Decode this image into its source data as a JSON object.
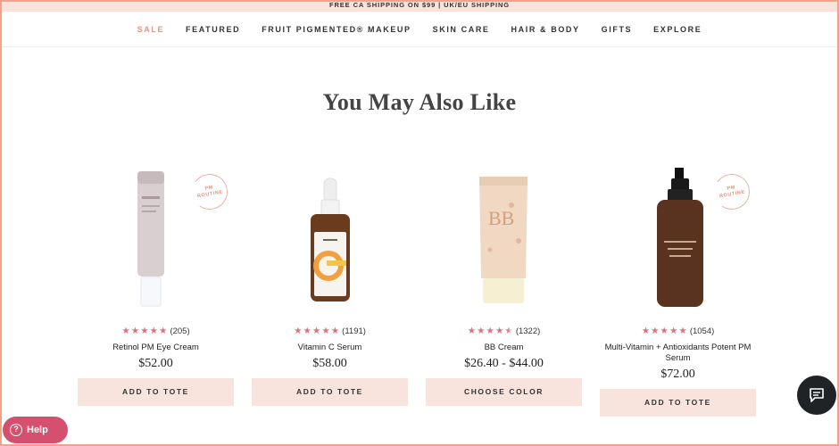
{
  "promo": {
    "text": "FREE CA SHIPPING ON $99 | UK/EU SHIPPING"
  },
  "nav": {
    "items": [
      {
        "label": "SALE"
      },
      {
        "label": "FEATURED"
      },
      {
        "label": "FRUIT PIGMENTED® MAKEUP"
      },
      {
        "label": "SKIN CARE"
      },
      {
        "label": "HAIR & BODY"
      },
      {
        "label": "GIFTS"
      },
      {
        "label": "EXPLORE"
      }
    ]
  },
  "section": {
    "title": "You May Also Like"
  },
  "badge": {
    "line1": "PM",
    "line2": "ROUTINE"
  },
  "products": [
    {
      "name": "Retinol PM Eye Cream",
      "price": "$52.00",
      "rating": 5,
      "reviews": "(205)",
      "button": "ADD TO TOTE",
      "badge": true
    },
    {
      "name": "Vitamin C Serum",
      "price": "$58.00",
      "rating": 5,
      "reviews": "(1191)",
      "button": "ADD TO TOTE",
      "badge": false
    },
    {
      "name": "BB Cream",
      "price": "$26.40 - $44.00",
      "rating": 4.5,
      "reviews": "(1322)",
      "button": "CHOOSE COLOR",
      "badge": false
    },
    {
      "name": "Multi-Vitamin + Antioxidants Potent PM Serum",
      "price": "$72.00",
      "rating": 5,
      "reviews": "(1054)",
      "button": "ADD TO TOTE",
      "badge": true
    }
  ],
  "help": {
    "label": "Help"
  },
  "colors": {
    "accent": "#e6957b",
    "button_bg": "#f9e3dd",
    "star": "#d9737b",
    "help_bg": "#d4506e",
    "frame": "#f3a189"
  },
  "icons": {
    "chat": "chat-icon",
    "help": "question-icon",
    "star": "star-icon"
  }
}
